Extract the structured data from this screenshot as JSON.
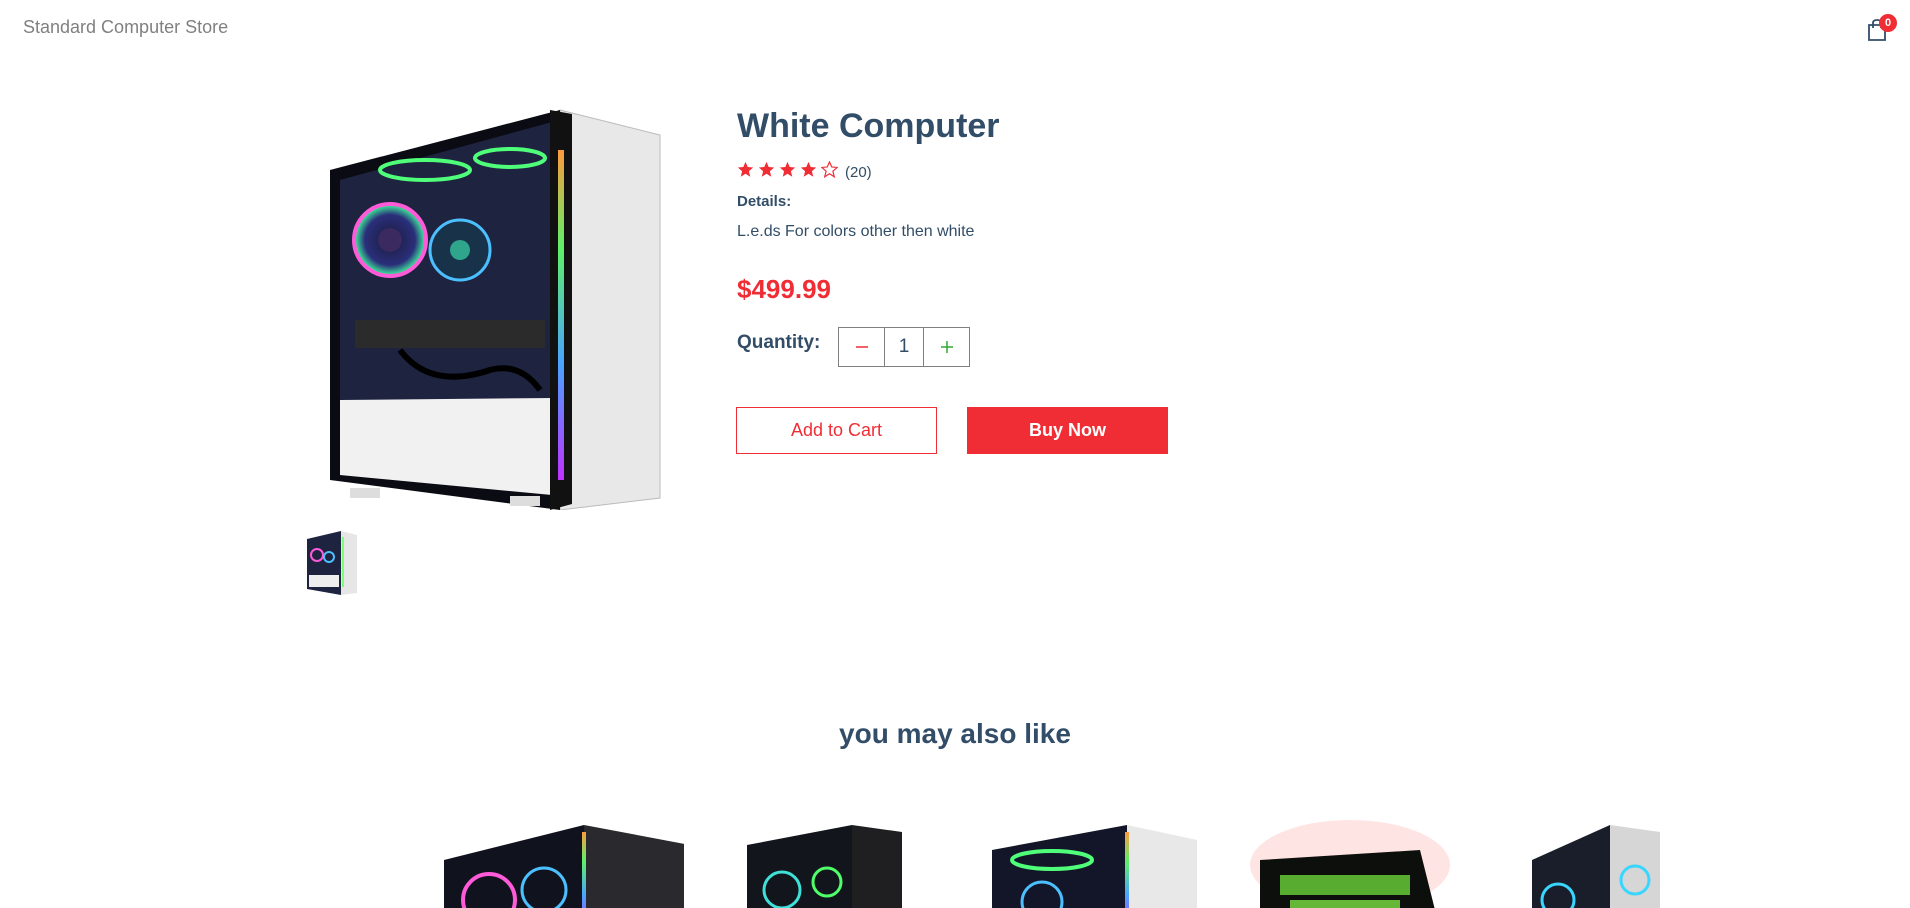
{
  "navbar": {
    "store_name": "Standard Computer Store",
    "cart_icon": "shopping-bag-icon",
    "cart_count": "0"
  },
  "product": {
    "name": "White Computer",
    "rating": 4,
    "max_rating": 5,
    "review_count": "(20)",
    "details_label": "Details:",
    "details": "L.e.ds For colors other then white",
    "price": "$499.99",
    "quantity_label": "Quantity:",
    "quantity": "1",
    "minus_icon": "minus-icon",
    "plus_icon": "plus-icon",
    "add_to_cart": "Add to Cart",
    "buy_now": "Buy Now"
  },
  "colors": {
    "accent": "#f02d34",
    "text": "#324d67",
    "plus": "#31a831",
    "muted": "#808080"
  },
  "related": {
    "title": "you may also like"
  }
}
